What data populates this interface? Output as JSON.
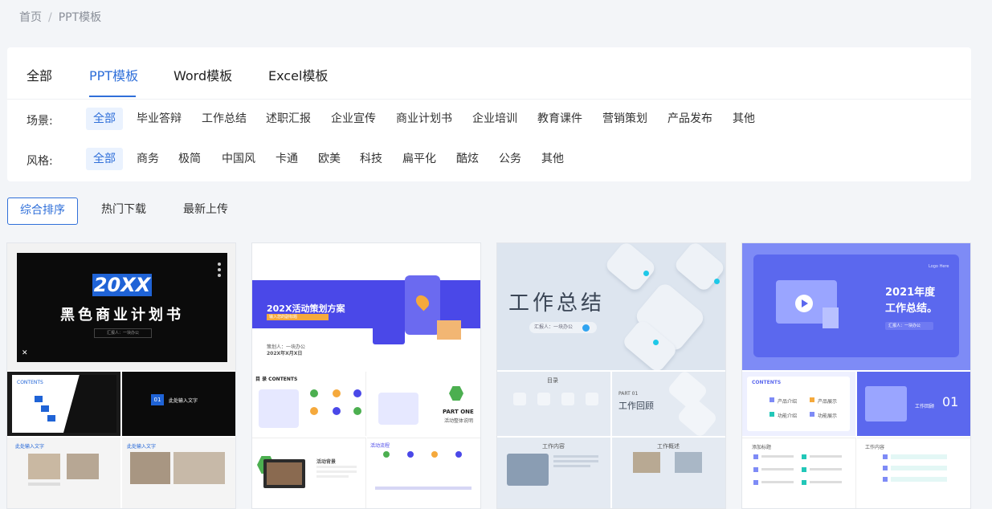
{
  "breadcrumb": {
    "home": "首页",
    "separator": "/",
    "current": "PPT模板"
  },
  "tabs": [
    {
      "label": "全部"
    },
    {
      "label": "PPT模板",
      "active": true
    },
    {
      "label": "Word模板"
    },
    {
      "label": "Excel模板"
    }
  ],
  "filters": {
    "scene": {
      "label": "场景:",
      "options": [
        "全部",
        "毕业答辩",
        "工作总结",
        "述职汇报",
        "企业宣传",
        "商业计划书",
        "企业培训",
        "教育课件",
        "营销策划",
        "产品发布",
        "其他"
      ]
    },
    "style": {
      "label": "风格:",
      "options": [
        "全部",
        "商务",
        "极简",
        "中国风",
        "卡通",
        "欧美",
        "科技",
        "扁平化",
        "酷炫",
        "公务",
        "其他"
      ]
    }
  },
  "sort": [
    "综合排序",
    "热门下载",
    "最新上传"
  ],
  "cards": [
    {
      "theme_color": "#111111",
      "cover_big": "20XX",
      "cover_title": "黑色商业计划书",
      "cover_sub": "汇报人：一块办公",
      "tile1": "CONTENTS",
      "tile2_num": "01",
      "tile2_text": "此处输入文字",
      "tile3": "此处输入文字",
      "tile4": "此处输入文字"
    },
    {
      "theme_color": "#4a48e8",
      "cover_title": "202X活动策划方案",
      "cover_sub": "输入您的副标题",
      "cover_presenter": "策划人：一块办公",
      "cover_date": "202X年X月X日",
      "tile1": "目 录  CONTENTS",
      "tile2": "PART ONE",
      "tile2_sub": "活动整体说明",
      "tile3": "活动背景",
      "tile4": "活动流程"
    },
    {
      "theme_color": "#dde5ef",
      "cover_title": "工作总结",
      "cover_sub": "汇报人：一块办公",
      "tile1": "目录",
      "tile2_part": "PART 01",
      "tile2": "工作回顾",
      "tile3": "工作内容",
      "tile4": "工作概述"
    },
    {
      "theme_color": "#7e8bf6",
      "cover_title_1": "2021年度",
      "cover_title_2": "工作总结。",
      "cover_sub": "汇报人：一块办公",
      "cover_logo": "Logo Here",
      "tile1": "CONTENTS",
      "tile1_items": [
        "产品介绍",
        "产品展示",
        "功能介绍",
        "功能展示"
      ],
      "tile2": "工作回顾",
      "tile2_num": "01",
      "tile3": "添加标题",
      "tile4": "工作内容"
    }
  ]
}
